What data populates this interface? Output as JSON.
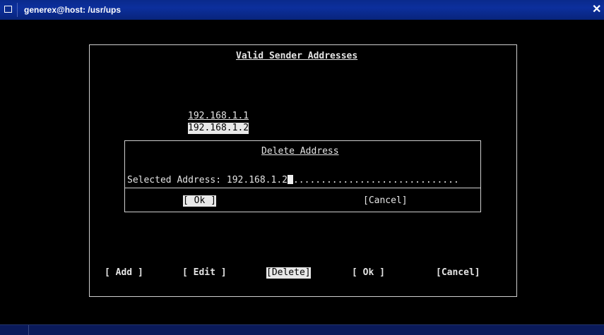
{
  "window": {
    "title": "generex@host: /usr/ups",
    "close_glyph": "✕"
  },
  "dialog": {
    "title": "Valid Sender Addresses",
    "addresses": [
      "192.168.1.1",
      "192.168.1.2"
    ],
    "buttons": {
      "add": "[ Add ]",
      "edit": "[ Edit ]",
      "delete": "[Delete]",
      "ok": "[ Ok ]",
      "cancel": "[Cancel]"
    }
  },
  "subdialog": {
    "title": "Delete Address",
    "field_label": "Selected Address:",
    "field_value": "192.168.1.2",
    "field_fill": "..............................",
    "ok": "[ Ok ]",
    "cancel": "[Cancel]"
  },
  "colors": {
    "titlebar": "#0c2f9d",
    "text": "#e4e4e4",
    "background": "#000000"
  }
}
